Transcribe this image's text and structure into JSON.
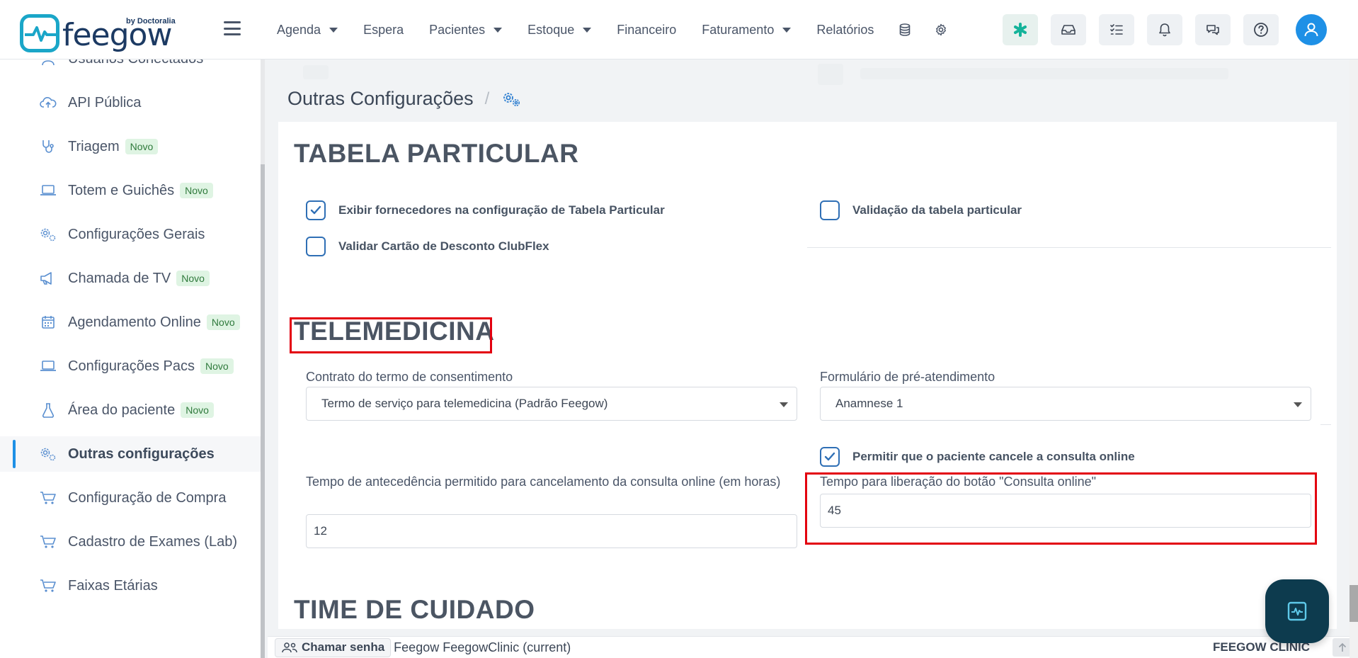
{
  "app": {
    "logo_text": "feegow",
    "logo_by": "by Doctoralia"
  },
  "nav": {
    "items": [
      {
        "label": "Agenda",
        "dropdown": true
      },
      {
        "label": "Espera",
        "dropdown": false
      },
      {
        "label": "Pacientes",
        "dropdown": true
      },
      {
        "label": "Estoque",
        "dropdown": true
      },
      {
        "label": "Financeiro",
        "dropdown": false
      },
      {
        "label": "Faturamento",
        "dropdown": true
      },
      {
        "label": "Relatórios",
        "dropdown": false
      }
    ],
    "icons": [
      "database-icon",
      "gear-icon"
    ],
    "right_buttons": [
      "asterisk-icon",
      "inbox-icon",
      "checklist-icon",
      "bell-icon",
      "chat-icon",
      "help-icon"
    ],
    "accent": "#1e90e6"
  },
  "sidebar": {
    "items": [
      {
        "label": "Usuários Conectados",
        "icon": "user-icon",
        "badge": ""
      },
      {
        "label": "API Pública",
        "icon": "cloud-upload-icon",
        "badge": ""
      },
      {
        "label": "Triagem",
        "icon": "stethoscope-icon",
        "badge": "Novo"
      },
      {
        "label": "Totem e Guichês",
        "icon": "laptop-icon",
        "badge": "Novo"
      },
      {
        "label": "Configurações Gerais",
        "icon": "gears-icon",
        "badge": ""
      },
      {
        "label": "Chamada de TV",
        "icon": "megaphone-icon",
        "badge": "Novo"
      },
      {
        "label": "Agendamento Online",
        "icon": "calendar-icon",
        "badge": "Novo"
      },
      {
        "label": "Configurações Pacs",
        "icon": "laptop-icon",
        "badge": "Novo"
      },
      {
        "label": "Área do paciente",
        "icon": "flask-icon",
        "badge": "Novo"
      },
      {
        "label": "Outras configurações",
        "icon": "gears-icon",
        "badge": "",
        "active": true
      },
      {
        "label": "Configuração de Compra",
        "icon": "cart-icon",
        "badge": ""
      },
      {
        "label": "Cadastro de Exames (Lab)",
        "icon": "cart-icon",
        "badge": ""
      },
      {
        "label": "Faixas Etárias",
        "icon": "cart-icon",
        "badge": ""
      }
    ]
  },
  "page": {
    "title": "Outras Configurações",
    "crumb_sep": "/"
  },
  "tabela": {
    "heading": "TABELA PARTICULAR",
    "options": [
      {
        "label": "Exibir fornecedores na configuração de Tabela Particular",
        "checked": true
      },
      {
        "label": "Validação da tabela particular",
        "checked": false
      },
      {
        "label": "Validar Cartão de Desconto ClubFlex",
        "checked": false
      }
    ]
  },
  "telemedicina": {
    "heading": "TELEMEDICINA",
    "contrato_label": "Contrato do termo de consentimento",
    "contrato_value": "Termo de serviço para telemedicina (Padrão Feegow)",
    "formulario_label": "Formulário de pré-atendimento",
    "formulario_value": "Anamnese 1",
    "permitir_label": "Permitir que o paciente cancele a consulta online",
    "permitir_checked": true,
    "antecedencia_label": "Tempo de antecedência permitido para cancelamento da consulta online (em horas)",
    "antecedencia_value": "12",
    "liberacao_label": "Tempo para liberação do botão \"Consulta online\"",
    "liberacao_value": "45"
  },
  "time_cuidado": {
    "heading": "TIME DE CUIDADO"
  },
  "footer": {
    "chamar_label": "Chamar senha",
    "unit": "Feegow FeegowClinic (current)",
    "brand": "FEEGOW CLINIC"
  }
}
